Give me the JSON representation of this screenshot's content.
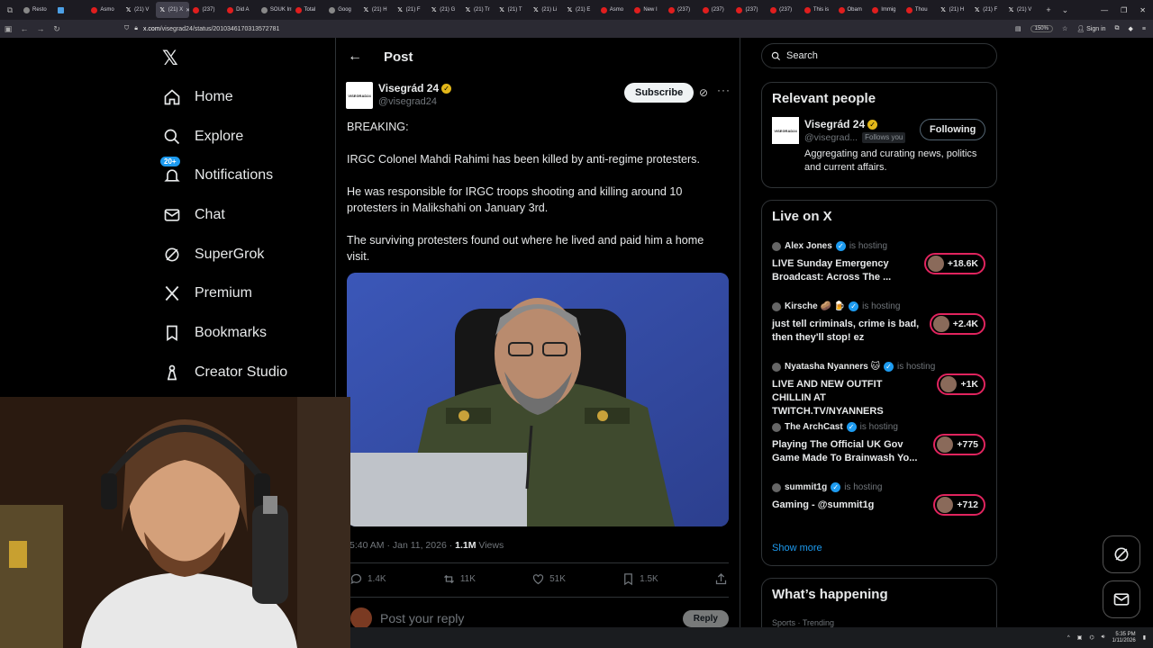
{
  "browser": {
    "tabs": [
      {
        "label": "Resto",
        "icon": "clock-icon"
      },
      {
        "label": "",
        "icon": "blue-square-icon"
      },
      {
        "label": "Asmo",
        "icon": "youtube-icon"
      },
      {
        "label": "(21) V",
        "icon": "x-icon"
      },
      {
        "label": "(21) X",
        "icon": "x-icon",
        "active": true
      },
      {
        "label": "(237)",
        "icon": "youtube-icon"
      },
      {
        "label": "Did A",
        "icon": "youtube-icon"
      },
      {
        "label": "SOUK Inte",
        "icon": "page-icon"
      },
      {
        "label": "Total",
        "icon": "youtube-icon"
      },
      {
        "label": "Goog",
        "icon": "google-icon"
      },
      {
        "label": "(21) H",
        "icon": "x-icon"
      },
      {
        "label": "(21) F",
        "icon": "x-icon"
      },
      {
        "label": "(21) G",
        "icon": "x-icon"
      },
      {
        "label": "(21) Tr",
        "icon": "x-icon"
      },
      {
        "label": "(21) T",
        "icon": "x-icon"
      },
      {
        "label": "(21) Li",
        "icon": "x-icon"
      },
      {
        "label": "(21) E",
        "icon": "x-icon"
      },
      {
        "label": "Asmo",
        "icon": "youtube-icon"
      },
      {
        "label": "New I",
        "icon": "youtube-icon"
      },
      {
        "label": "(237)",
        "icon": "youtube-icon"
      },
      {
        "label": "(237)",
        "icon": "youtube-icon"
      },
      {
        "label": "(237)",
        "icon": "youtube-icon"
      },
      {
        "label": "(237)",
        "icon": "youtube-icon"
      },
      {
        "label": "This is",
        "icon": "youtube-icon"
      },
      {
        "label": "Obam",
        "icon": "youtube-icon"
      },
      {
        "label": "Immig",
        "icon": "youtube-icon"
      },
      {
        "label": "Thou",
        "icon": "youtube-icon"
      },
      {
        "label": "(21) H",
        "icon": "x-icon"
      },
      {
        "label": "(21) F",
        "icon": "x-icon"
      },
      {
        "label": "(21) V",
        "icon": "x-icon"
      }
    ],
    "url_prefix": "x.com",
    "url_path": "/visegrad24/status/2010346170313572781",
    "zoom": "150%",
    "signin": "Sign in"
  },
  "nav": {
    "items": [
      {
        "label": "Home",
        "icon": "home-icon"
      },
      {
        "label": "Explore",
        "icon": "search-icon"
      },
      {
        "label": "Notifications",
        "icon": "bell-icon",
        "badge": "20+"
      },
      {
        "label": "Chat",
        "icon": "mail-icon"
      },
      {
        "label": "SuperGrok",
        "icon": "grok-icon"
      },
      {
        "label": "Premium",
        "icon": "x-icon"
      },
      {
        "label": "Bookmarks",
        "icon": "bookmark-icon"
      },
      {
        "label": "Creator Studio",
        "icon": "creator-icon"
      }
    ]
  },
  "post": {
    "header_title": "Post",
    "author_name": "Visegrád 24",
    "author_handle": "@visegrad24",
    "avatar_text": "VISEGRAD24",
    "subscribe_label": "Subscribe",
    "paragraphs": [
      "BREAKING:",
      "IRGC Colonel Mahdi Rahimi has been killed by anti-regime protesters.",
      "He was responsible for IRGC troops shooting and killing around 10 protesters in Malikshahi on January 3rd.",
      "The surviving protesters found out where he lived and paid him a home visit."
    ],
    "time": "5:40 AM · Jan 11, 2026 · ",
    "views_count": "1.1M",
    "views_label": " Views",
    "actions": {
      "replies": "1.4K",
      "reposts": "11K",
      "likes": "51K",
      "bookmarks": "1.5K"
    },
    "reply_placeholder": "Post your reply",
    "reply_button": "Reply"
  },
  "sidebar": {
    "search_placeholder": "Search",
    "relevant_people": {
      "title": "Relevant people",
      "name": "Visegrád 24",
      "handle": "@visegrad...",
      "follows_you": "Follows you",
      "following_label": "Following",
      "bio": "Aggregating and curating news, politics and current affairs."
    },
    "live": {
      "title": "Live on X",
      "hosting_label": "is hosting",
      "items": [
        {
          "host": "Alex Jones",
          "badge": "verified-blue",
          "title": "LIVE Sunday Emergency Broadcast: Across The ...",
          "count": "+18.6K"
        },
        {
          "host": "Kirsche 🥔 🍺",
          "badge": "verified-blue",
          "title": "just tell criminals, crime is bad, then they'll stop! ez",
          "count": "+2.4K"
        },
        {
          "host": "Nyatasha Nyanners 🐱",
          "badge": "verified-blue",
          "title": "LIVE AND NEW OUTFIT CHILLIN AT TWITCH.TV/NYANNERS",
          "count": "+1K"
        },
        {
          "host": "The ArchCast",
          "badge": "verified-blue",
          "title": "Playing The Official UK Gov Game Made To Brainwash Yo...",
          "count": "+775"
        },
        {
          "host": "summit1g",
          "badge": "verified-blue",
          "title": "Gaming - @summit1g",
          "count": "+712"
        }
      ],
      "show_more": "Show more"
    },
    "happening": {
      "title": "What’s happening",
      "subtitle": "Sports · Trending"
    }
  },
  "taskbar": {
    "time": "5:35 PM",
    "date": "1/11/2026"
  }
}
